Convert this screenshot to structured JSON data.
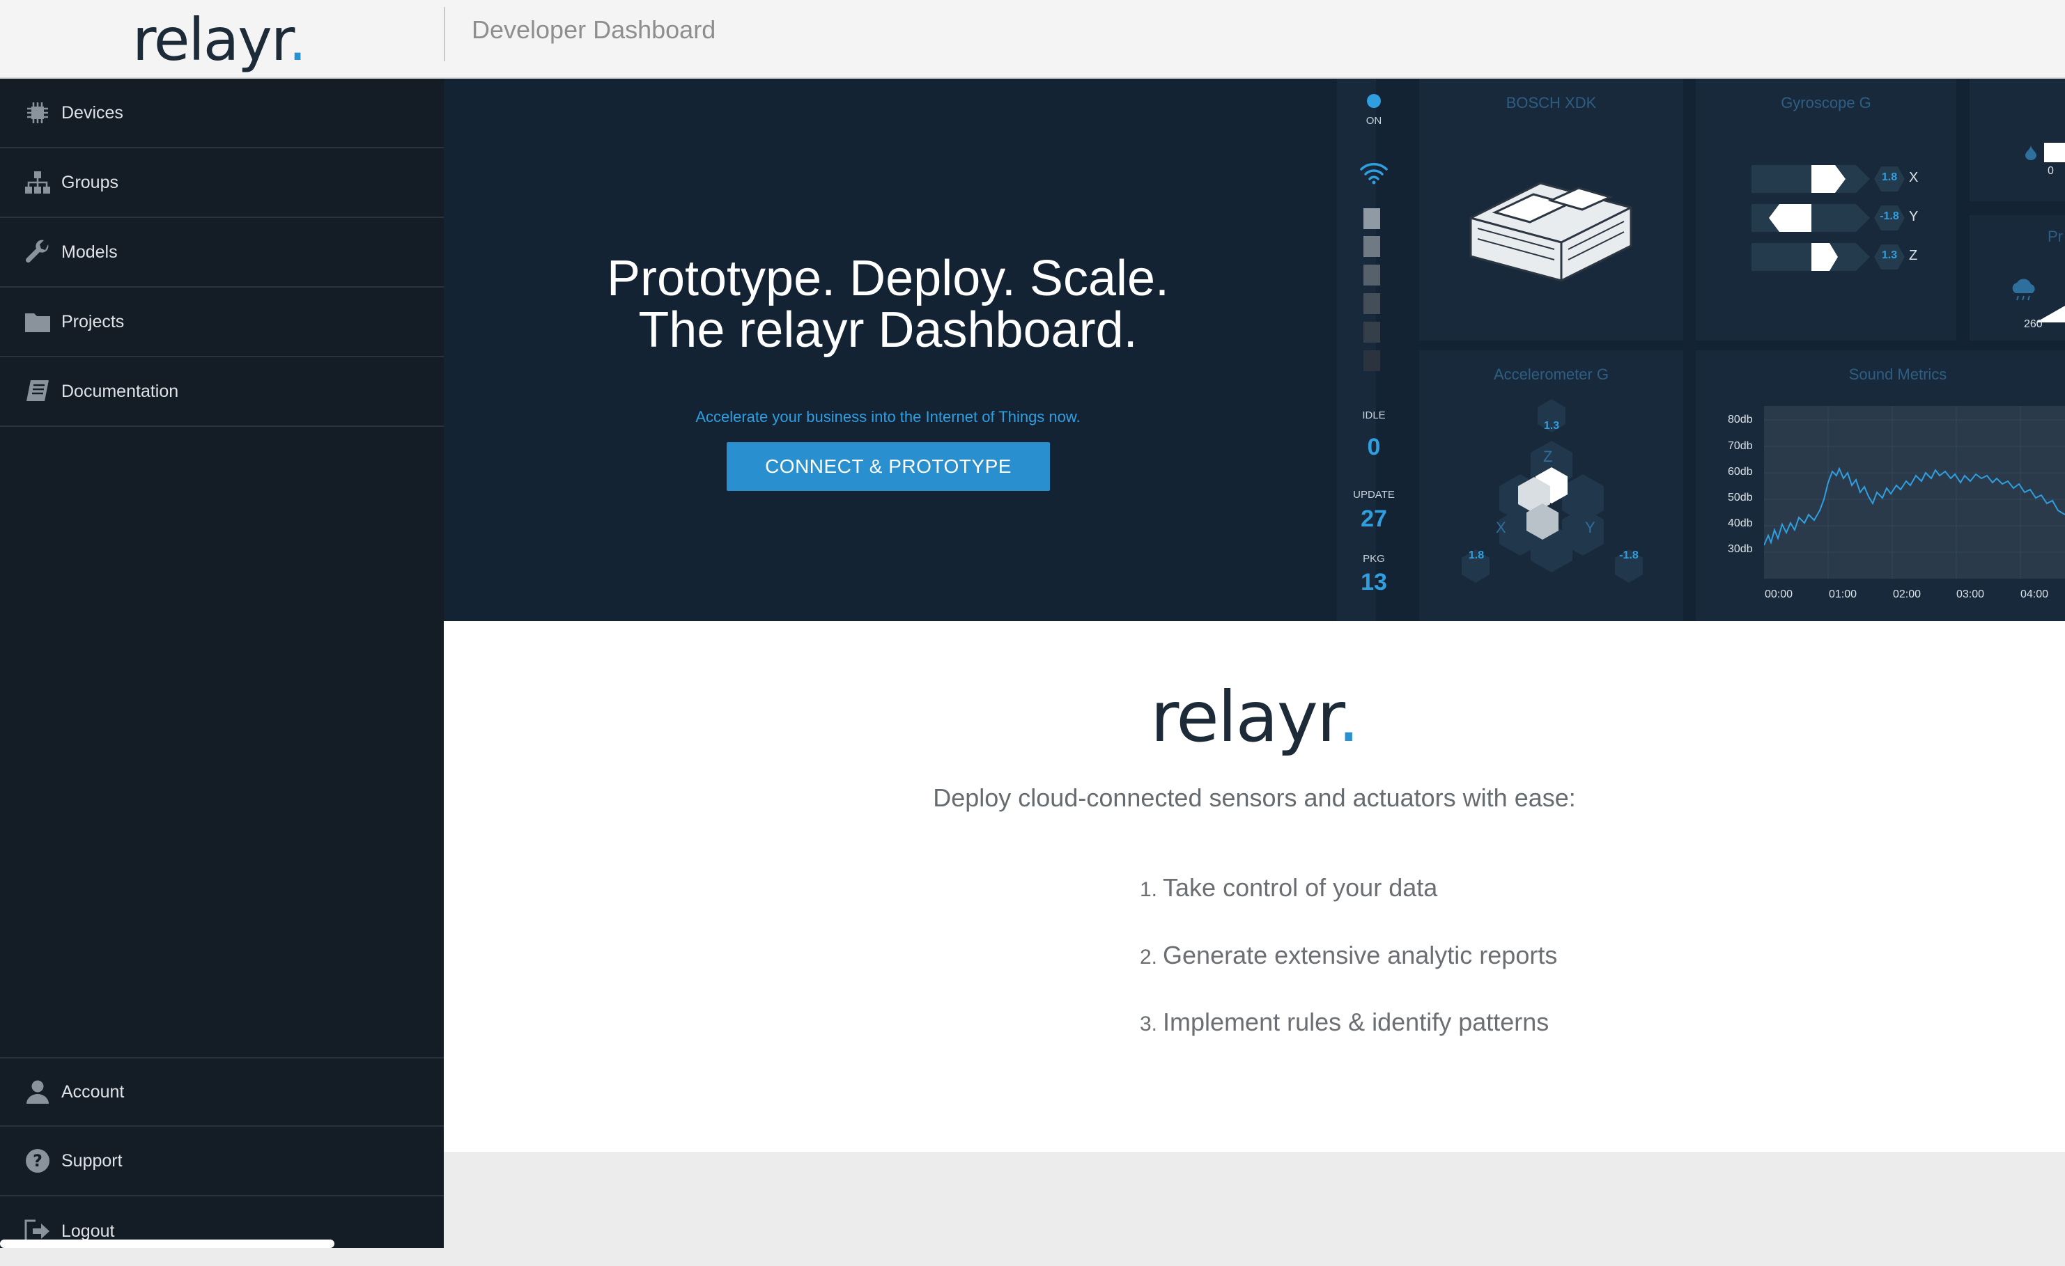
{
  "header": {
    "logo_text": "relayr",
    "logo_dot": ".",
    "title": "Developer Dashboard"
  },
  "sidebar": {
    "items": [
      {
        "label": "Devices",
        "icon": "chip-icon"
      },
      {
        "label": "Groups",
        "icon": "hierarchy-icon"
      },
      {
        "label": "Models",
        "icon": "wrench-icon"
      },
      {
        "label": "Projects",
        "icon": "folder-icon"
      },
      {
        "label": "Documentation",
        "icon": "book-icon"
      }
    ],
    "bottom_items": [
      {
        "label": "Account",
        "icon": "user-icon"
      },
      {
        "label": "Support",
        "icon": "help-icon"
      },
      {
        "label": "Logout",
        "icon": "logout-icon"
      }
    ]
  },
  "hero": {
    "headline_line1": "Prototype. Deploy. Scale.",
    "headline_line2": "The relayr Dashboard.",
    "subtext": "Accelerate your business into the Internet of Things now.",
    "cta_label": "CONNECT & PROTOTYPE",
    "preview": {
      "status_on": "ON",
      "idle_label": "IDLE",
      "idle_value": "0",
      "update_label": "UPDATE",
      "update_value": "27",
      "pkg_label": "PKG",
      "pkg_value": "13",
      "device_panel_title": "BOSCH XDK",
      "gyro_title": "Gyroscope G",
      "gyro": [
        {
          "axis": "X",
          "value": "1.8"
        },
        {
          "axis": "Y",
          "value": "-1.8"
        },
        {
          "axis": "Z",
          "value": "1.3"
        }
      ],
      "side_small_value_top": "0",
      "side_small_label": "Pr",
      "side_small_value_bottom": "260",
      "accel_title": "Accelerometer G",
      "accel_values": {
        "z": "1.3",
        "x": "1.8",
        "y": "-1.8"
      },
      "accel_axes": {
        "z": "Z",
        "x": "X",
        "y": "Y"
      },
      "sound_title": "Sound Metrics",
      "sound_y_ticks": [
        "80db",
        "70db",
        "60db",
        "50db",
        "40db",
        "30db"
      ],
      "sound_x_ticks": [
        "00:00",
        "01:00",
        "02:00",
        "03:00",
        "04:00"
      ]
    }
  },
  "content": {
    "logo_text": "relayr",
    "logo_dot": ".",
    "tagline": "Deploy cloud-connected sensors and actuators with ease:",
    "steps": [
      {
        "num": "1.",
        "text": "Take control of your data"
      },
      {
        "num": "2.",
        "text": "Generate extensive analytic reports"
      },
      {
        "num": "3.",
        "text": "Implement rules & identify patterns"
      }
    ]
  },
  "colors": {
    "accent": "#2a8fcf",
    "sidebar_bg": "#141c25",
    "hero_bg": "#132333",
    "panel_bg": "#17293a"
  }
}
